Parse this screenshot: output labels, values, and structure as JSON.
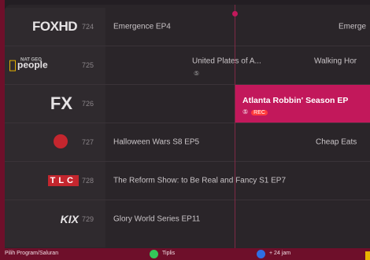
{
  "channels": [
    {
      "logo": "FOXHD",
      "number": "724",
      "programs": [
        "Emergence EP4",
        "Emerge"
      ]
    },
    {
      "logo": "people",
      "logo_small": "NAT GEO",
      "number": "725",
      "programs": [
        "United Plates of A...",
        "Walking Hor"
      ]
    },
    {
      "logo": "FX",
      "number": "726",
      "programs": [
        "Atlanta Robbin' Season EP"
      ]
    },
    {
      "logo": "",
      "number": "727",
      "programs": [
        "Halloween Wars S8 EP5",
        "Cheap Eats"
      ]
    },
    {
      "logo": "TLC",
      "number": "728",
      "programs": [
        "The Reform Show: to Be Real and Fancy S1 EP7"
      ]
    },
    {
      "logo": "KIX",
      "number": "729",
      "programs": [
        "Glory World Series EP11"
      ]
    }
  ],
  "selected_badges": {
    "cc": "⑤",
    "rec": "REC"
  },
  "footer": {
    "select_label": "Pilih Program/Saluran",
    "green_label": "Tiplis",
    "blue_label": "+ 24 jam"
  },
  "colors": {
    "accent": "#c2185b",
    "footer": "#6e0f2a",
    "green": "#34c759",
    "blue": "#2f6fe4"
  },
  "icons": [
    "subtitle-icon",
    "record-icon",
    "green-button-icon",
    "blue-button-icon"
  ]
}
